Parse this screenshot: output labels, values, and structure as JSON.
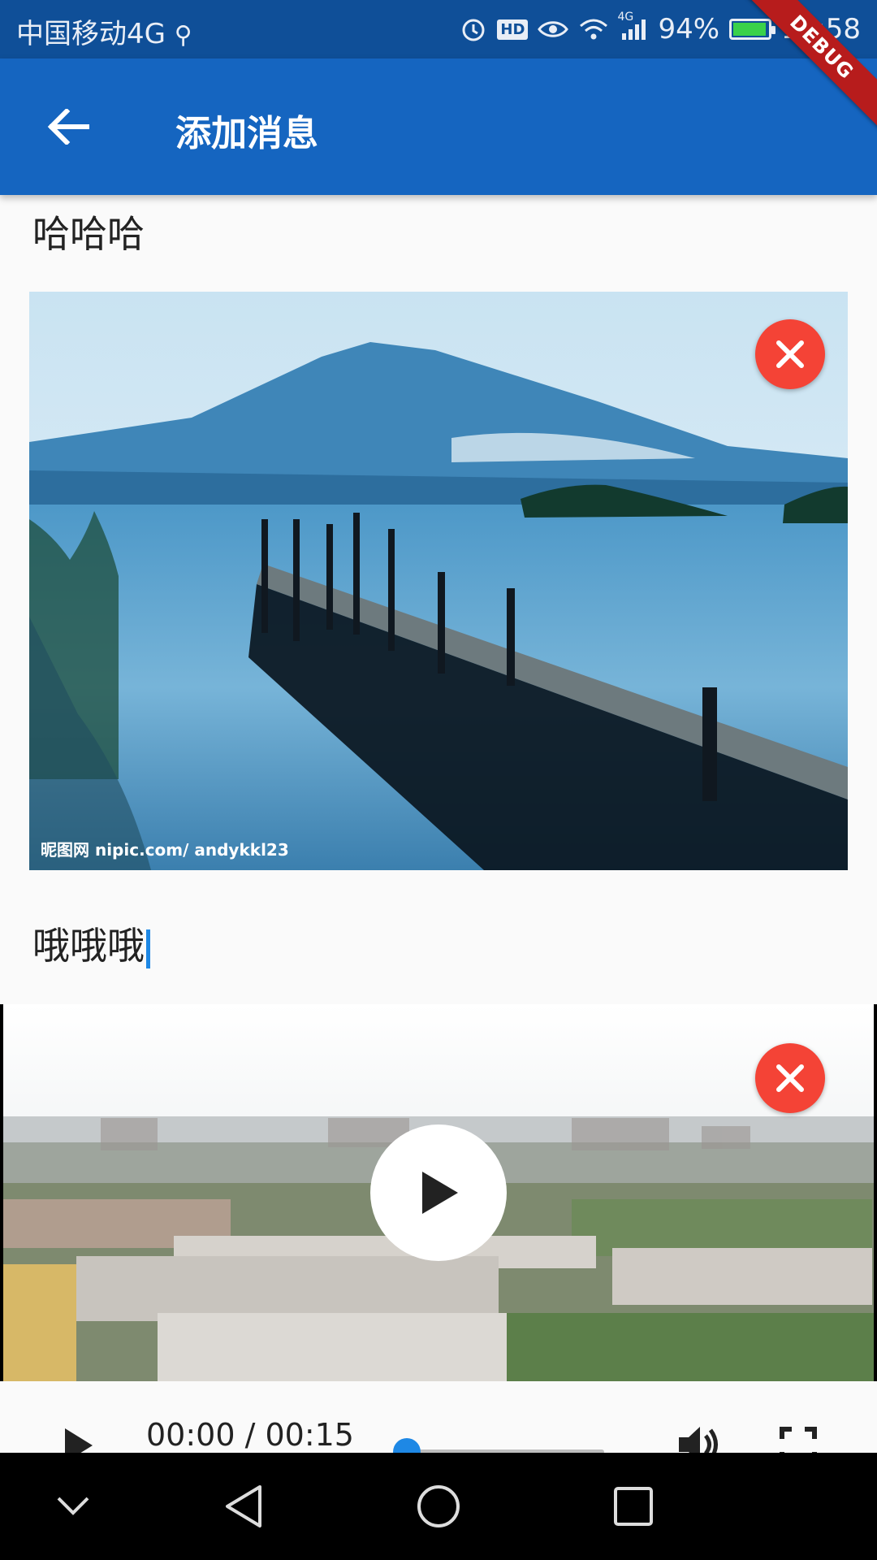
{
  "status_bar": {
    "carrier": "中国移动4G",
    "network_tag": "4G",
    "battery": "94%",
    "time": "10:58",
    "icons": [
      "usb-icon",
      "alarm-icon",
      "hd-icon",
      "eye-icon",
      "wifi-icon",
      "signal-icon",
      "battery-icon"
    ]
  },
  "debug_banner": "DEBUG",
  "app_bar": {
    "title": "添加消息",
    "back_icon": "arrow-back-icon"
  },
  "content": {
    "text1": "哈哈哈",
    "image": {
      "watermark": "昵图网 nipic.com/ andykkl23"
    },
    "text2": "哦哦哦",
    "video": {
      "time": "00:00 / 00:15",
      "progress": 0
    }
  },
  "colors": {
    "primary": "#1565c0",
    "status_bar": "#0f4f98",
    "remove": "#f44336",
    "accent": "#1e88e5"
  },
  "nav_bar": {
    "icons": [
      "chevron-down-icon",
      "back-triangle-icon",
      "home-circle-icon",
      "recents-square-icon"
    ]
  }
}
